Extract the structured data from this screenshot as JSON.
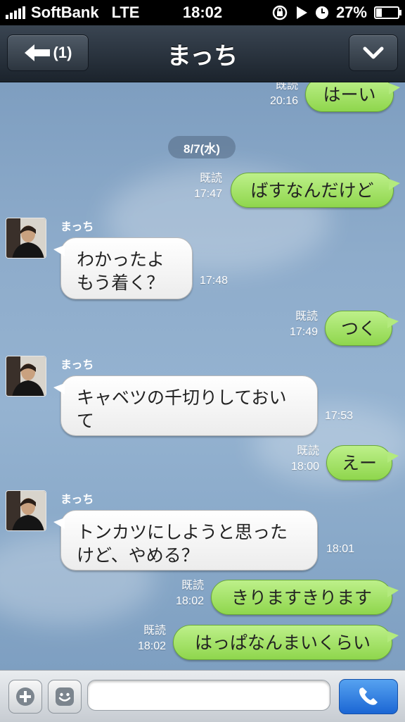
{
  "status_bar": {
    "carrier": "SoftBank",
    "network": "LTE",
    "time": "18:02",
    "battery": "27%",
    "battery_level": 0.27
  },
  "nav": {
    "back_label": "(1)",
    "title": "まっち"
  },
  "chat": {
    "date_divider": "8/7(水)",
    "sender_name": "まっち",
    "read_label": "既読",
    "messages": [
      {
        "side": "sent",
        "text": "はーい",
        "time": "20:16"
      },
      {
        "side": "sent",
        "text": "ばすなんだけど",
        "time": "17:47"
      },
      {
        "side": "received",
        "lines": [
          "わかったよ",
          "もう着く？"
        ],
        "time": "17:48"
      },
      {
        "side": "sent",
        "text": "つく",
        "time": "17:49"
      },
      {
        "side": "received",
        "lines": [
          "キャベツの千切りしておい",
          "て"
        ],
        "time": "17:53"
      },
      {
        "side": "sent",
        "text": "えー",
        "time": "18:00"
      },
      {
        "side": "received",
        "lines": [
          "トンカツにしようと思った",
          "けど、やめる？"
        ],
        "time": "18:01"
      },
      {
        "side": "sent",
        "text": "きりますきります",
        "time": "18:02"
      },
      {
        "side": "sent",
        "text": "はっぱなんまいくらい",
        "time": "18:02"
      }
    ]
  },
  "input_bar": {
    "placeholder": ""
  },
  "colors": {
    "sent_bubble": "#9edf5e",
    "received_bubble": "#ffffff",
    "call_button": "#2a78e0",
    "chat_bg": "#8eaccb"
  }
}
